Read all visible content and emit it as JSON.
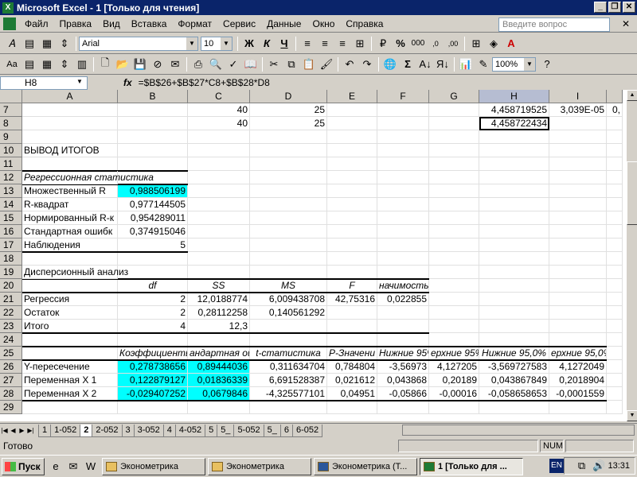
{
  "title": "Microsoft Excel - 1  [Только для чтения]",
  "menu": [
    "Файл",
    "Правка",
    "Вид",
    "Вставка",
    "Формат",
    "Сервис",
    "Данные",
    "Окно",
    "Справка"
  ],
  "help_placeholder": "Введите вопрос",
  "font_name": "Arial",
  "font_size": "10",
  "zoom": "100%",
  "name_box": "H8",
  "fx": "fx",
  "formula": "=$B$26+$B$27*C8+$B$28*D8",
  "columns": [
    "A",
    "B",
    "C",
    "D",
    "E",
    "F",
    "G",
    "H",
    "I"
  ],
  "rows": [
    "7",
    "8",
    "9",
    "10",
    "11",
    "12",
    "13",
    "14",
    "15",
    "16",
    "17",
    "18",
    "19",
    "20",
    "21",
    "22",
    "23",
    "24",
    "25",
    "26",
    "27",
    "28",
    "29"
  ],
  "cells": {
    "r7": {
      "C": "40",
      "D": "25",
      "H": "4,458719525",
      "I": "3,039E-05",
      "J": "0,"
    },
    "r8": {
      "C": "40",
      "D": "25",
      "H": "4,458722434"
    },
    "r10": {
      "A": "ВЫВОД ИТОГОВ"
    },
    "r12": {
      "A": "Регрессионная статистика"
    },
    "r13": {
      "A": "Множественный R",
      "B": "0,988506199"
    },
    "r14": {
      "A": "R-квадрат",
      "B": "0,977144505"
    },
    "r15": {
      "A": "Нормированный R-к",
      "B": "0,954289011"
    },
    "r16": {
      "A": "Стандартная ошибк",
      "B": "0,374915046"
    },
    "r17": {
      "A": "Наблюдения",
      "B": "5"
    },
    "r19": {
      "A": "Дисперсионный анализ"
    },
    "r20": {
      "B": "df",
      "C": "SS",
      "D": "MS",
      "E": "F",
      "F": "начимость F"
    },
    "r21": {
      "A": "Регрессия",
      "B": "2",
      "C": "12,0188774",
      "D": "6,009438708",
      "E": "42,75316",
      "F": "0,022855"
    },
    "r22": {
      "A": "Остаток",
      "B": "2",
      "C": "0,28112258",
      "D": "0,140561292"
    },
    "r23": {
      "A": "Итого",
      "B": "4",
      "C": "12,3"
    },
    "r25": {
      "B": "Коэффициенты",
      "C": "андартная ош",
      "D": "t-статистика",
      "E": "Р-Значени",
      "F": "Нижние 95%",
      "G": "ерхние 95%",
      "H": "Нижние 95,0%",
      "I": "ерхние 95,0%"
    },
    "r26": {
      "A": "Y-пересечение",
      "B": "0,278738656",
      "C": "0,89444036",
      "D": "0,311634704",
      "E": "0,784804",
      "F": "-3,56973",
      "G": "4,127205",
      "H": "-3,569727583",
      "I": "4,1272049"
    },
    "r27": {
      "A": "Переменная X 1",
      "B": "0,122879127",
      "C": "0,01836339",
      "D": "6,691528387",
      "E": "0,021612",
      "F": "0,043868",
      "G": "0,20189",
      "H": "0,043867849",
      "I": "0,2018904"
    },
    "r28": {
      "A": "Переменная X 2",
      "B": "-0,029407252",
      "C": "0,0679846",
      "D": "-4,325577101",
      "E": "0,04951",
      "F": "-0,05866",
      "G": "-0,00016",
      "H": "-0,058658653",
      "I": "-0,0001559"
    }
  },
  "sheet_tabs": [
    "1",
    "1-052",
    "2",
    "2-052",
    "3",
    "3-052",
    "4",
    "4-052",
    "5",
    "5_",
    "5-052",
    "5_",
    "6",
    "6-052"
  ],
  "active_tab": "2",
  "status": "Готово",
  "num": "NUM",
  "start": "Пуск",
  "tasks": [
    "Эконометрика",
    "Эконометрика",
    "Эконометрика (Т...",
    "1  [Только для ..."
  ],
  "lang": "EN",
  "clock": "13:31"
}
